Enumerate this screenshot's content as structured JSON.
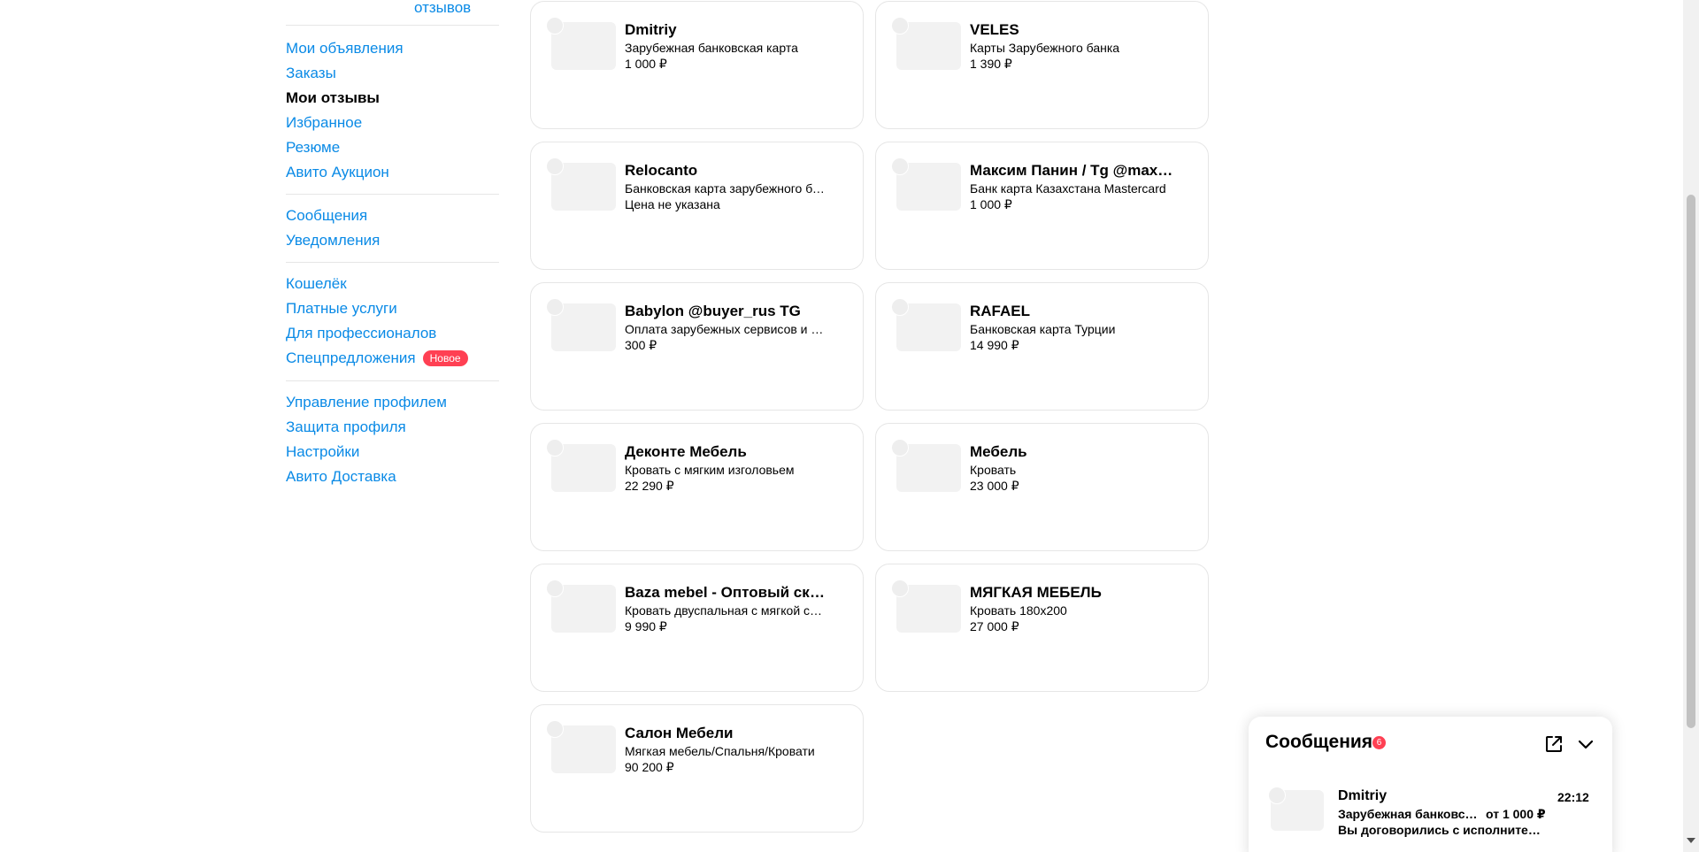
{
  "sidebar": {
    "reviews_link": "отзывов",
    "groups": [
      [
        "Мои объявления",
        "Заказы",
        "Мои отзывы",
        "Избранное",
        "Резюме",
        "Авито Аукцион"
      ],
      [
        "Сообщения",
        "Уведомления"
      ],
      [
        "Кошелёк",
        "Платные услуги",
        "Для профессионалов",
        "Спецпредложения"
      ],
      [
        "Управление профилем",
        "Защита профиля",
        "Настройки",
        "Авито Доставка"
      ]
    ],
    "active_item": "Мои отзывы",
    "new_badge": "Новое"
  },
  "cards": [
    {
      "seller": "Dmitriy",
      "item": "Зарубежная банковская карта",
      "price": "1 000 ₽"
    },
    {
      "seller": "VELES",
      "item": "Карты Зарубежного банка",
      "price": "1 390 ₽"
    },
    {
      "seller": "Relocanto",
      "item": "Банковская карта зарубежного банка",
      "price": "Цена не указана"
    },
    {
      "seller": "Максим Панин / Tg @maxpanin",
      "item": "Банк карта Казахстана Mastercard",
      "price": "1 000 ₽"
    },
    {
      "seller": "Babylon @buyer_rus TG",
      "item": "Оплата зарубежных сервисов и покупок",
      "price": "300 ₽"
    },
    {
      "seller": "RAFAEL",
      "item": "Банковская карта Турции",
      "price": "14 990 ₽"
    },
    {
      "seller": "Деконте Мебель",
      "item": "Кровать с мягким изголовьем",
      "price": "22 290 ₽"
    },
    {
      "seller": "Мебель",
      "item": "Кровать",
      "price": "23 000 ₽"
    },
    {
      "seller": "Baza mebel - Оптовый склад мебели",
      "item": "Кровать двуспальная с мягкой спинкой",
      "price": "9 990 ₽"
    },
    {
      "seller": "МЯГКАЯ МЕБЕЛЬ",
      "item": "Кровать 180х200",
      "price": "27 000 ₽"
    },
    {
      "seller": "Салон Мебели",
      "item": "Мягкая мебель/Спальня/Кровати",
      "price": "90 200 ₽"
    }
  ],
  "messages": {
    "title": "Сообщения",
    "unread_count": "6",
    "open_icon": "external-link-icon",
    "collapse_icon": "chevron-down-icon",
    "items": [
      {
        "name": "Dmitriy",
        "time": "22:12",
        "item_title": "Зарубежная банковская карта",
        "item_price": "от 1 000 ₽",
        "last_message": "Вы договорились с исполнителем"
      }
    ]
  },
  "colors": {
    "link": "#0a8ae6",
    "badge": "#ff4053",
    "border": "#e6e6e6",
    "placeholder": "#f2f2f2"
  }
}
